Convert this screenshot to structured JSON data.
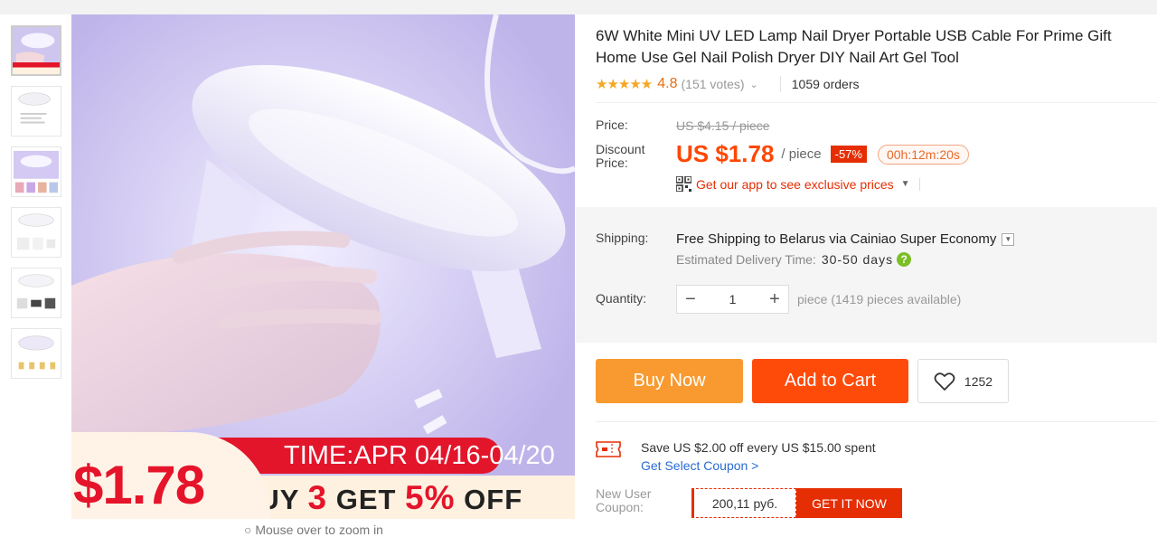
{
  "product": {
    "title": "6W White Mini UV LED Lamp Nail Dryer Portable USB Cable For Prime Gift Home Use Gel Nail Polish Dryer DIY Nail Art Gel Tool",
    "stars": "★★★★★",
    "rating": "4.8",
    "votes": "(151 votes)",
    "orders": "1059 orders"
  },
  "gallery": {
    "thumb_count": 6,
    "promo": {
      "price": "$1.78",
      "time": "TIME:APR 04/16-04/20",
      "buy_line_1": "BUY ",
      "buy_num": "3",
      "buy_line_2": " GET ",
      "buy_pct": "5%",
      "buy_line_3": " OFF"
    },
    "zoom_hint": "○ Mouse over to zoom in"
  },
  "price": {
    "label": "Price:",
    "original": "US $4.15 / piece",
    "discount_label_1": "Discount",
    "discount_label_2": "Price:",
    "discount_amount": "US $1.78",
    "unit": "/ piece",
    "discount_pct": "-57%",
    "timer": "00h:12m:20s",
    "app_promo": "Get our app to see exclusive prices"
  },
  "shipping": {
    "label": "Shipping:",
    "free": "Free Shipping to",
    "destination": " Belarus via Cainiao Super Economy",
    "eta_label": "Estimated Delivery Time:",
    "eta_days": "30-50 days",
    "help_icon": "?"
  },
  "quantity": {
    "label": "Quantity:",
    "minus": "−",
    "value": "1",
    "plus": "+",
    "available": "piece (1419 pieces available)"
  },
  "actions": {
    "buy_now": "Buy Now",
    "add_to_cart": "Add to Cart",
    "wishlist_count": "1252"
  },
  "coupons": {
    "store_offer": "Save US $2.00 off every US $15.00 spent",
    "store_link": "Get Select Coupon >",
    "new_user_label_1": "New User",
    "new_user_label_2": "Coupon:",
    "new_user_amount": "200,11 руб.",
    "new_user_button": "GET IT NOW"
  },
  "colors": {
    "accent_orange": "#ff4600",
    "buy_now": "#f89a2f",
    "add_to_cart": "#ff4b0a",
    "badge_red": "#e62e04",
    "link_blue": "#2a6bd2"
  }
}
